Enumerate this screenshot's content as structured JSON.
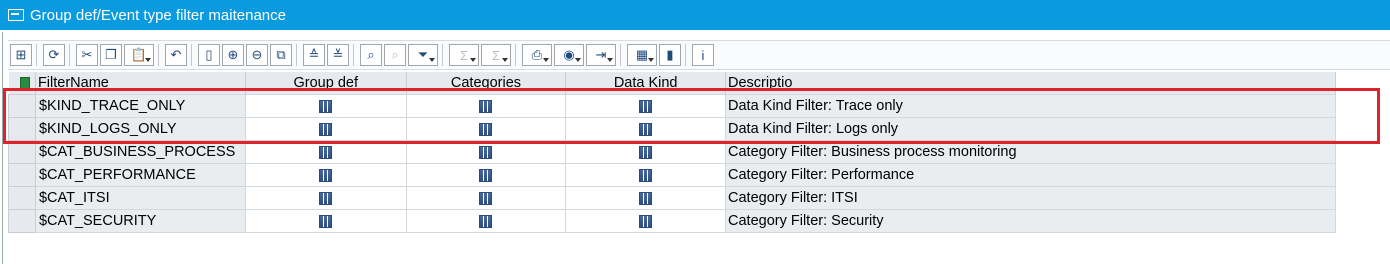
{
  "window": {
    "title": "Group def/Event type filter maitenance"
  },
  "toolbar": {
    "buttons": [
      {
        "icon": "details-icon",
        "glyph": "⊞"
      },
      {
        "icon": "refresh-icon",
        "glyph": "⟳"
      },
      {
        "icon": "cut-icon",
        "glyph": "✂"
      },
      {
        "icon": "copy-icon",
        "glyph": "❐"
      },
      {
        "icon": "paste-icon",
        "glyph": "📋",
        "dropdown": true
      },
      {
        "icon": "undo-icon",
        "glyph": "↶"
      },
      {
        "icon": "new-row-icon",
        "glyph": "▯"
      },
      {
        "icon": "insert-row-icon",
        "glyph": "⊕"
      },
      {
        "icon": "delete-row-icon",
        "glyph": "⊖"
      },
      {
        "icon": "copy-row-icon",
        "glyph": "⧉"
      },
      {
        "icon": "sort-ascending-icon",
        "glyph": "≙"
      },
      {
        "icon": "sort-descending-icon",
        "glyph": "≚"
      },
      {
        "icon": "find-icon",
        "glyph": "⌕"
      },
      {
        "icon": "find-next-icon",
        "glyph": "⌕",
        "disabled": true
      },
      {
        "icon": "filter-icon",
        "glyph": "⏷",
        "dropdown": true
      },
      {
        "icon": "sum-icon",
        "glyph": "Σ",
        "dropdown": true,
        "disabled": true
      },
      {
        "icon": "subtotal-icon",
        "glyph": "Σ",
        "dropdown": true,
        "disabled": true
      },
      {
        "icon": "print-icon",
        "glyph": "⎙",
        "dropdown": true
      },
      {
        "icon": "views-icon",
        "glyph": "◉",
        "dropdown": true
      },
      {
        "icon": "export-icon",
        "glyph": "⇥",
        "dropdown": true
      },
      {
        "icon": "layout-icon",
        "glyph": "▦",
        "dropdown": true
      },
      {
        "icon": "graphic-icon",
        "glyph": "▮"
      },
      {
        "icon": "info-icon",
        "glyph": "i"
      }
    ]
  },
  "grid": {
    "columns": [
      "FilterName",
      "Group def",
      "Categories",
      "Data Kind",
      "Descriptio"
    ],
    "rows": [
      {
        "name": "$KIND_TRACE_ONLY",
        "desc": "Data Kind Filter: Trace only"
      },
      {
        "name": "$KIND_LOGS_ONLY",
        "desc": "Data Kind Filter: Logs only"
      },
      {
        "name": "$CAT_BUSINESS_PROCESS",
        "desc": "Category Filter: Business process monitoring"
      },
      {
        "name": "$CAT_PERFORMANCE",
        "desc": "Category Filter: Performance"
      },
      {
        "name": "$CAT_ITSI",
        "desc": "Category Filter: ITSI"
      },
      {
        "name": "$CAT_SECURITY",
        "desc": "Category Filter: Security"
      }
    ]
  },
  "colors": {
    "titlebar": "#0a9ae0",
    "highlight": "#e0222a"
  }
}
